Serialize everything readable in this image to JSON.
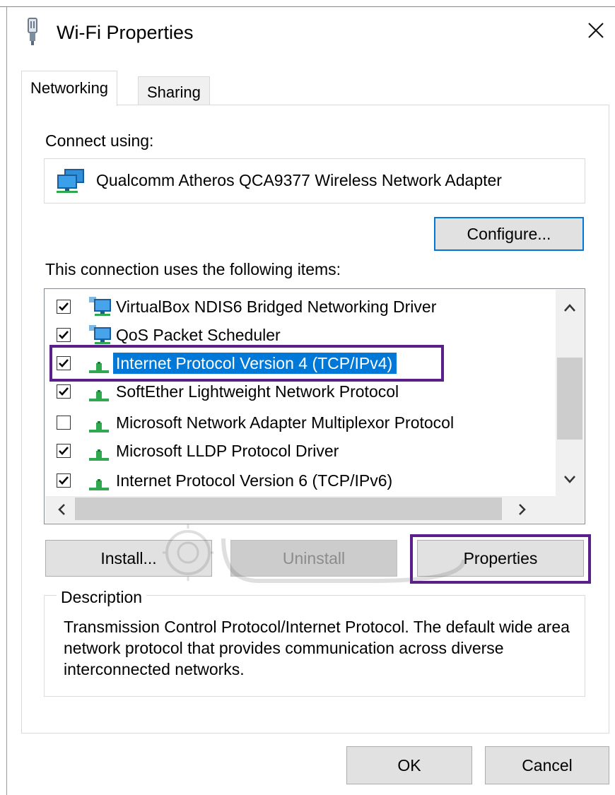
{
  "window": {
    "title": "Wi-Fi Properties",
    "icon": "wifi-adapter-icon",
    "close_label": "close-icon"
  },
  "tabs": [
    {
      "label": "Networking",
      "active": true
    },
    {
      "label": "Sharing",
      "active": false
    }
  ],
  "connect_using": {
    "label": "Connect using:",
    "adapter_name": "Qualcomm Atheros QCA9377 Wireless Network Adapter",
    "configure_label": "Configure..."
  },
  "items_section": {
    "label": "This connection uses the following items:",
    "items": [
      {
        "label": "VirtualBox NDIS6 Bridged Networking Driver",
        "checked": true,
        "icon": "network-service-icon",
        "selected": false
      },
      {
        "label": "QoS Packet Scheduler",
        "checked": true,
        "icon": "network-service-icon",
        "selected": false
      },
      {
        "label": "Internet Protocol Version 4 (TCP/IPv4)",
        "checked": true,
        "icon": "protocol-icon",
        "selected": true
      },
      {
        "label": "SoftEther Lightweight Network Protocol",
        "checked": true,
        "icon": "protocol-icon",
        "selected": false
      },
      {
        "label": "Microsoft Network Adapter Multiplexor Protocol",
        "checked": false,
        "icon": "protocol-icon",
        "selected": false
      },
      {
        "label": "Microsoft LLDP Protocol Driver",
        "checked": true,
        "icon": "protocol-icon",
        "selected": false
      },
      {
        "label": "Internet Protocol Version 6 (TCP/IPv6)",
        "checked": true,
        "icon": "protocol-icon",
        "selected": false
      }
    ]
  },
  "buttons": {
    "install": "Install...",
    "uninstall": "Uninstall",
    "properties": "Properties",
    "ok": "OK",
    "cancel": "Cancel"
  },
  "description": {
    "title": "Description",
    "text": "Transmission Control Protocol/Internet Protocol. The default wide area network protocol that provides communication across diverse interconnected networks."
  },
  "colors": {
    "selection": "#0078d7",
    "highlight_outline": "#5b1f8a",
    "button_face": "#e1e1e1"
  }
}
